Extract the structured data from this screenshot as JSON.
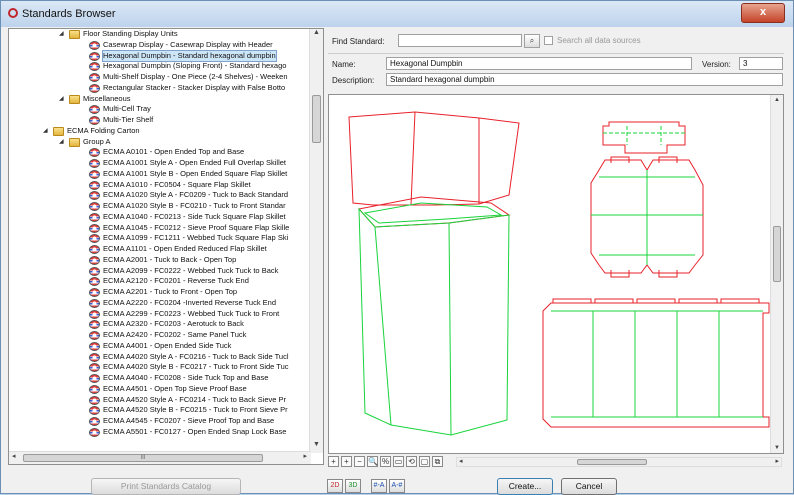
{
  "window": {
    "title": "Standards Browser",
    "close_glyph": "x"
  },
  "tree": {
    "items": [
      {
        "level": 3,
        "kind": "folder",
        "expanded": true,
        "label": "Floor Standing Display Units"
      },
      {
        "level": 4,
        "kind": "std",
        "label": "Casewrap Display - Casewrap Display with Header"
      },
      {
        "level": 4,
        "kind": "std",
        "label": "Hexagonal Dumpbin - Standard hexagonal dumpbin",
        "selected": true
      },
      {
        "level": 4,
        "kind": "std",
        "label": "Hexagonal Dumpbin (Sloping Front) - Standard hexago"
      },
      {
        "level": 4,
        "kind": "std",
        "label": "Multi-Shelf Display - One Piece (2-4 Shelves) - Weeken"
      },
      {
        "level": 4,
        "kind": "std",
        "label": "Rectangular Stacker - Stacker Display with False Botto"
      },
      {
        "level": 3,
        "kind": "folder",
        "expanded": true,
        "label": "Miscellaneous"
      },
      {
        "level": 4,
        "kind": "std",
        "label": "Multi-Cell Tray"
      },
      {
        "level": 4,
        "kind": "std",
        "label": "Multi-Tier Shelf"
      },
      {
        "level": 2,
        "kind": "folder",
        "expanded": true,
        "label": "ECMA Folding Carton"
      },
      {
        "level": 3,
        "kind": "folder",
        "expanded": true,
        "label": "Group A"
      },
      {
        "level": 4,
        "kind": "std",
        "label": "ECMA A0101 - Open Ended Top and Base"
      },
      {
        "level": 4,
        "kind": "std",
        "label": "ECMA A1001 Style A - Open Ended Full Overlap Skillet"
      },
      {
        "level": 4,
        "kind": "std",
        "label": "ECMA A1001 Style B - Open Ended Square Flap Skillet"
      },
      {
        "level": 4,
        "kind": "std",
        "label": "ECMA A1010 - FC0504 - Square Flap Skillet"
      },
      {
        "level": 4,
        "kind": "std",
        "label": "ECMA A1020 Style A - FC0209 - Tuck to Back Standard"
      },
      {
        "level": 4,
        "kind": "std",
        "label": "ECMA A1020 Style B - FC0210 - Tuck to Front Standar"
      },
      {
        "level": 4,
        "kind": "std",
        "label": "ECMA A1040 - FC0213 - Side Tuck Square Flap Skillet"
      },
      {
        "level": 4,
        "kind": "std",
        "label": "ECMA A1045 - FC0212 - Sieve Proof Square Flap Skille"
      },
      {
        "level": 4,
        "kind": "std",
        "label": "ECMA A1099 - FC1211 - Webbed Tuck Square Flap Ski"
      },
      {
        "level": 4,
        "kind": "std",
        "label": "ECMA A1101 - Open Ended Reduced Flap Skillet"
      },
      {
        "level": 4,
        "kind": "std",
        "label": "ECMA A2001 - Tuck to Back - Open Top"
      },
      {
        "level": 4,
        "kind": "std",
        "label": "ECMA A2099 - FC0222 - Webbed Tuck Tuck to Back"
      },
      {
        "level": 4,
        "kind": "std",
        "label": "ECMA A2120 - FC0201 - Reverse Tuck End"
      },
      {
        "level": 4,
        "kind": "std",
        "label": "ECMA A2201 - Tuck to Front - Open Top"
      },
      {
        "level": 4,
        "kind": "std",
        "label": "ECMA A2220 - FC0204 -Inverted Reverse Tuck End"
      },
      {
        "level": 4,
        "kind": "std",
        "label": "ECMA A2299 - FC0223 - Webbed Tuck Tuck to Front"
      },
      {
        "level": 4,
        "kind": "std",
        "label": "ECMA A2320 - FC0203 - Aerotuck to Back"
      },
      {
        "level": 4,
        "kind": "std",
        "label": "ECMA A2420 - FC0202 - Same Panel Tuck"
      },
      {
        "level": 4,
        "kind": "std",
        "label": "ECMA A4001 - Open Ended Side Tuck"
      },
      {
        "level": 4,
        "kind": "std",
        "label": "ECMA A4020 Style A - FC0216 - Tuck to Back Side Tucl"
      },
      {
        "level": 4,
        "kind": "std",
        "label": "ECMA A4020 Style B - FC0217 - Tuck to Front Side Tuc"
      },
      {
        "level": 4,
        "kind": "std",
        "label": "ECMA A4040 - FC0208 - Side Tuck Top and Base"
      },
      {
        "level": 4,
        "kind": "std",
        "label": "ECMA A4501 - Open Top Sieve Proof Base"
      },
      {
        "level": 4,
        "kind": "std",
        "label": "ECMA A4520 Style A - FC0214 - Tuck to Back Sieve Pr"
      },
      {
        "level": 4,
        "kind": "std",
        "label": "ECMA A4520 Style B - FC0215 - Tuck to Front Sieve Pr"
      },
      {
        "level": 4,
        "kind": "std",
        "label": "ECMA A4545 - FC0207 - Sieve Proof Top and Base"
      },
      {
        "level": 4,
        "kind": "std",
        "label": "ECMA A5501 - FC0127 - Open Ended Snap Lock Base"
      }
    ],
    "hscroll_grip": "III"
  },
  "form": {
    "find_label": "Find Standard:",
    "find_value": "",
    "search_all_label": "Search all data sources",
    "name_label": "Name:",
    "name_value": "Hexagonal Dumpbin",
    "version_label": "Version:",
    "version_value": "3",
    "description_label": "Description:",
    "description_value": "Standard hexagonal dumpbin"
  },
  "colors": {
    "cut_line": "#e8202a",
    "crease_line": "#18d43a",
    "selection": "#cde6f7"
  },
  "preview_toolbar": {
    "buttons": [
      "+",
      "+",
      "−",
      "🔍",
      "%",
      "▭",
      "⟲",
      "▢",
      "⧉"
    ],
    "hscroll_grip": "III"
  },
  "bottom": {
    "print_label": "Print Standards Catalog",
    "create_label": "Create...",
    "cancel_label": "Cancel",
    "view_icons": [
      "2D",
      "3D"
    ],
    "sort_icons": [
      "#-A",
      "A-#"
    ]
  }
}
